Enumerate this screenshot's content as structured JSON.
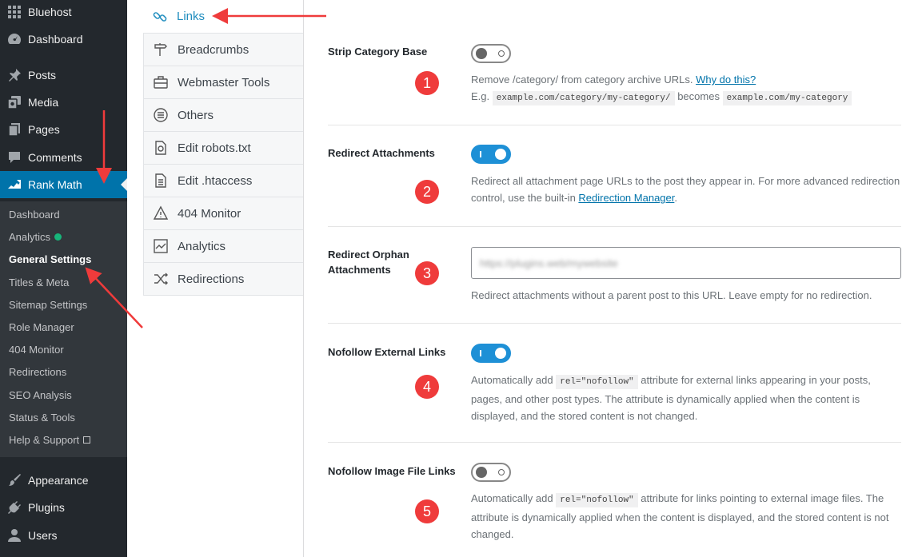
{
  "wp_sidebar": {
    "top_items": [
      {
        "label": "Bluehost",
        "icon": "grid-icon"
      },
      {
        "label": "Dashboard",
        "icon": "dashboard-icon"
      },
      {
        "label": "Posts",
        "icon": "pin-icon"
      },
      {
        "label": "Media",
        "icon": "media-icon"
      },
      {
        "label": "Pages",
        "icon": "pages-icon"
      },
      {
        "label": "Comments",
        "icon": "comment-icon"
      },
      {
        "label": "Rank Math",
        "icon": "rankmath-icon"
      }
    ],
    "submenu": [
      {
        "label": "Dashboard"
      },
      {
        "label": "Analytics",
        "badge": "green-dot"
      },
      {
        "label": "General Settings",
        "current": true
      },
      {
        "label": "Titles & Meta"
      },
      {
        "label": "Sitemap Settings"
      },
      {
        "label": "Role Manager"
      },
      {
        "label": "404 Monitor"
      },
      {
        "label": "Redirections"
      },
      {
        "label": "SEO Analysis"
      },
      {
        "label": "Status & Tools"
      },
      {
        "label": "Help & Support",
        "icon": "external-link-icon"
      }
    ],
    "bottom_items": [
      {
        "label": "Appearance",
        "icon": "brush-icon"
      },
      {
        "label": "Plugins",
        "icon": "plug-icon"
      },
      {
        "label": "Users",
        "icon": "users-icon"
      }
    ]
  },
  "settings_tabs": [
    {
      "label": "Links",
      "icon": "link-icon",
      "active": true
    },
    {
      "label": "Breadcrumbs",
      "icon": "signpost-icon"
    },
    {
      "label": "Webmaster Tools",
      "icon": "toolbox-icon"
    },
    {
      "label": "Others",
      "icon": "list-circle-icon"
    },
    {
      "label": "Edit robots.txt",
      "icon": "robot-file-icon"
    },
    {
      "label": "Edit .htaccess",
      "icon": "file-icon"
    },
    {
      "label": "404 Monitor",
      "icon": "warning-icon"
    },
    {
      "label": "Analytics",
      "icon": "chart-icon"
    },
    {
      "label": "Redirections",
      "icon": "shuffle-icon"
    }
  ],
  "settings": {
    "strip_category": {
      "label": "Strip Category Base",
      "enabled": false,
      "desc_text": "Remove /category/ from category archive URLs. ",
      "desc_link": "Why do this?",
      "eg_prefix": "E.g. ",
      "eg_code1": "example.com/category/my-category/",
      "eg_middle": " becomes ",
      "eg_code2": "example.com/my-category",
      "badge": "1"
    },
    "redirect_attachments": {
      "label": "Redirect Attachments",
      "enabled": true,
      "desc_text": "Redirect all attachment page URLs to the post they appear in. For more advanced redirection control, use the built-in ",
      "desc_link": "Redirection Manager",
      "desc_end": ".",
      "badge": "2"
    },
    "redirect_orphan": {
      "label_line1": "Redirect Orphan",
      "label_line2": "Attachments",
      "input_value": "https://plugins.web/mywebsite",
      "desc": "Redirect attachments without a parent post to this URL. Leave empty for no redirection.",
      "badge": "3"
    },
    "nofollow_external": {
      "label": "Nofollow External Links",
      "enabled": true,
      "desc_pre": "Automatically add ",
      "desc_code": "rel=\"nofollow\"",
      "desc_post": " attribute for external links appearing in your posts, pages, and other post types. The attribute is dynamically applied when the content is displayed, and the stored content is not changed.",
      "badge": "4"
    },
    "nofollow_image": {
      "label": "Nofollow Image File Links",
      "enabled": false,
      "desc_pre": "Automatically add ",
      "desc_code": "rel=\"nofollow\"",
      "desc_post": " attribute for links pointing to external image files. The attribute is dynamically applied when the content is displayed, and the stored content is not changed.",
      "badge": "5"
    }
  },
  "colors": {
    "annotation_red": "#ef3b3b",
    "wp_blue": "#0073aa",
    "toggle_on": "#1e90d6"
  }
}
